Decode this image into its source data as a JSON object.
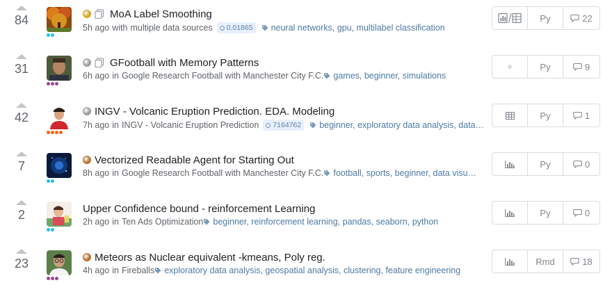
{
  "kernels": [
    {
      "votes": "84",
      "medal": "#d9a621",
      "has_copy": true,
      "title": "MoA Label Smoothing",
      "time": "5h ago",
      "connector": "with",
      "source": "multiple data sources",
      "badge": "0.01865",
      "tags": "neural networks, gpu, multilabel classification",
      "tier_color": "#20beff",
      "tier_dots": 2,
      "output_icon": "chart-table-icon",
      "language": "Py",
      "comments": "22",
      "avatar": "autumn-tree-avatar"
    },
    {
      "votes": "31",
      "medal": "#9e9e9e",
      "has_copy": true,
      "title": "GFootball with Memory Patterns",
      "time": "6h ago",
      "connector": "in",
      "source": "Google Research Football with Manchester City F.C.",
      "badge": "",
      "tags": "games, beginner, simulations",
      "tier_color": "#95488f",
      "tier_dots": 3,
      "output_icon": "dot-icon",
      "language": "Py",
      "comments": "9",
      "avatar": "man-portrait-avatar"
    },
    {
      "votes": "42",
      "medal": "#9e9e9e",
      "has_copy": false,
      "title": "INGV - Volcanic Eruption Prediction. EDA. Modeling",
      "time": "7h ago",
      "connector": "in",
      "source": "INGV - Volcanic Eruption Prediction",
      "badge": "7164762",
      "tags": "beginner, exploratory data analysis, data…",
      "tier_color": "#f96517",
      "tier_dots": 4,
      "output_icon": "table-icon",
      "language": "Py",
      "comments": "1",
      "avatar": "man-red-shirt-avatar"
    },
    {
      "votes": "7",
      "medal": "#b87333",
      "has_copy": false,
      "title": "Vectorized Readable Agent for Starting Out",
      "time": "8h ago",
      "connector": "in",
      "source": "Google Research Football with Manchester City F.C.",
      "badge": "",
      "tags": "football, sports, beginner, data visu…",
      "tier_color": "#20beff",
      "tier_dots": 2,
      "output_icon": "bar-chart-icon",
      "language": "Py",
      "comments": "0",
      "avatar": "blue-night-avatar"
    },
    {
      "votes": "2",
      "medal": "",
      "has_copy": false,
      "title": "Upper Confidence bound - reinforcement Learning",
      "time": "2h ago",
      "connector": "in",
      "source": "Ten Ads Optimization",
      "badge": "",
      "tags": "beginner, reinforcement learning, pandas, seaborn, python",
      "tier_color": "#20beff",
      "tier_dots": 2,
      "output_icon": "bar-chart-icon",
      "language": "Py",
      "comments": "0",
      "avatar": "child-portrait-avatar"
    },
    {
      "votes": "23",
      "medal": "#b87333",
      "has_copy": false,
      "title": "Meteors as Nuclear equivalent -kmeans, Poly reg.",
      "time": "4h ago",
      "connector": "in",
      "source": "Fireballs",
      "badge": "",
      "tags": "exploratory data analysis, geospatial analysis, clustering, feature engineering",
      "tier_color": "#95488f",
      "tier_dots": 3,
      "output_icon": "bar-chart-icon",
      "language": "Rmd",
      "comments": "18",
      "avatar": "man-glasses-avatar"
    }
  ]
}
